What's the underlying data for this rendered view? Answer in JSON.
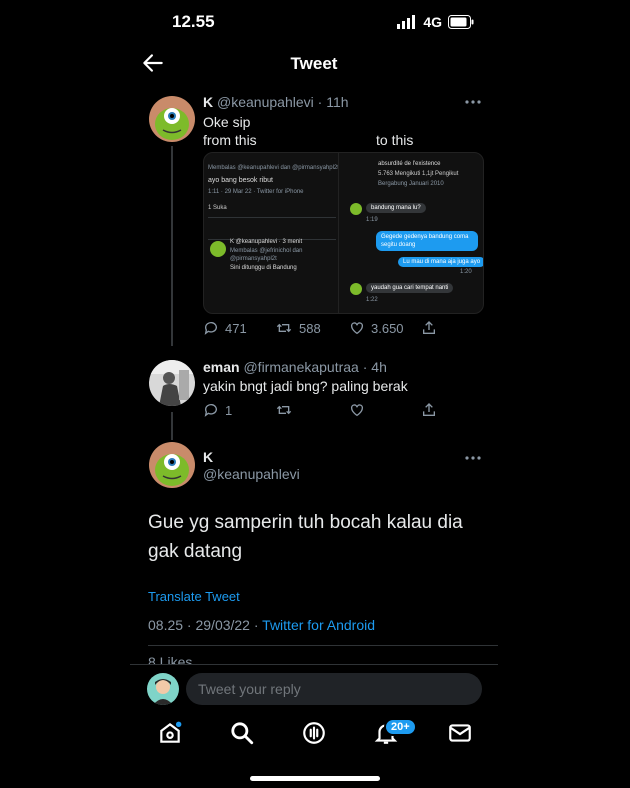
{
  "status_bar": {
    "time": "12.55",
    "network": "4G"
  },
  "header": {
    "title": "Tweet"
  },
  "thread": [
    {
      "name": "K",
      "handle": "@keanupahlevi",
      "time": "· 11h",
      "text_line1": "Oke sip",
      "text_from": "from this",
      "text_to": "to this",
      "media": {
        "left_replying": "Membalas @keanupahlevi dan @pirmansyahpl2t",
        "left_text": "ayo bang besok ribut",
        "left_meta": "1:11 · 29 Mar 22 · Twitter for iPhone",
        "left_likes": "1 Suka",
        "left_reply_name": "K @keanupahlevi · 3 menit",
        "left_reply_to": "Membalas @jefrinichol dan @pirmansyahpl2t",
        "left_reply_text": "Sini ditunggu di Bandung",
        "right_bio": "absurdité de l'existence",
        "right_stats": "5.763 Mengikuti  1,1jt Pengikut",
        "right_joined": "Bergabung Januari 2010",
        "dm_1": "bandung mana lu?",
        "dm_1_time": "1:19",
        "dm_2": "Gegede gedenya bandung coma segitu doang",
        "dm_3": "Lu mau di mana aja juga ayo",
        "dm_3_time": "1:20",
        "dm_4": "yaudah gua cari tempat nanti",
        "dm_4_time": "1:22"
      },
      "replies": "471",
      "retweets": "588",
      "likes": "3.650"
    },
    {
      "name": "eman",
      "handle": "@firmanekaputraa",
      "time": "· 4h",
      "text": "yakin bngt jadi bng? paling berak",
      "replies": "1"
    }
  ],
  "main_tweet": {
    "name": "K",
    "handle": "@keanupahlevi",
    "text": "Gue yg samperin tuh bocah kalau dia gak datang",
    "translate": "Translate Tweet",
    "timestamp": "08.25 · 29/03/22 · ",
    "source": "Twitter for Android",
    "likes_partial": "8 Likes"
  },
  "reply_bar": {
    "placeholder": "Tweet your reply"
  },
  "nav": {
    "notif_badge": "20+"
  },
  "colors": {
    "accent": "#1d9bf0",
    "muted": "#8b98a5",
    "background": "#000000"
  },
  "icons": [
    "back-arrow-icon",
    "more-dots-icon",
    "reply-icon",
    "retweet-icon",
    "like-icon",
    "share-icon",
    "home-icon",
    "search-icon",
    "spaces-icon",
    "notifications-icon",
    "messages-icon"
  ]
}
